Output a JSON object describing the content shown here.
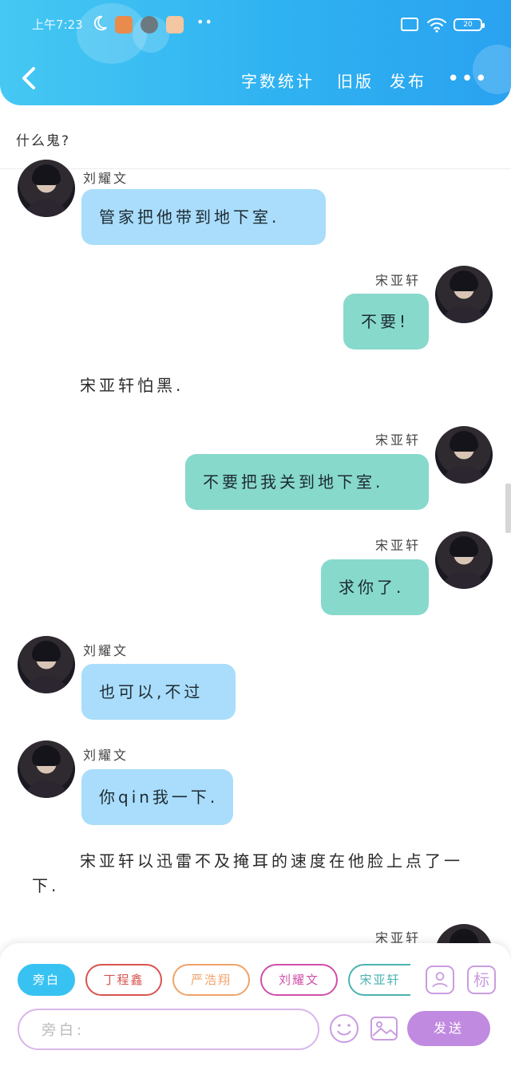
{
  "status_bar": {
    "time": "上午7:23",
    "battery_level": "20"
  },
  "nav": {
    "back_icon": "chevron-left-icon",
    "word_count_label": "字数统计",
    "old_version_label": "旧版",
    "publish_label": "发布",
    "more_icon": "more-dots-icon"
  },
  "story": {
    "title": "什么鬼?"
  },
  "messages": [
    {
      "type": "chat",
      "side": "left",
      "sender": "刘耀文",
      "text": "管家把他带到地下室."
    },
    {
      "type": "chat",
      "side": "right",
      "sender": "宋亚轩",
      "text": "不要!"
    },
    {
      "type": "narration",
      "text": "宋亚轩怕黑."
    },
    {
      "type": "chat",
      "side": "right",
      "sender": "宋亚轩",
      "text": "不要把我关到地下室."
    },
    {
      "type": "chat",
      "side": "right",
      "sender": "宋亚轩",
      "text": "求你了."
    },
    {
      "type": "chat",
      "side": "left",
      "sender": "刘耀文",
      "text": "也可以,不过"
    },
    {
      "type": "chat",
      "side": "left",
      "sender": "刘耀文",
      "text": "你qin我一下."
    },
    {
      "type": "narration",
      "text": "宋亚轩以迅雷不及掩耳的速度在他脸上点了一下."
    },
    {
      "type": "chat",
      "side": "right",
      "sender": "宋亚轩",
      "text": ""
    }
  ],
  "composer": {
    "roles": [
      {
        "label": "旁白",
        "color": "#38c2f2",
        "active": true
      },
      {
        "label": "丁程鑫",
        "color": "#d9534f",
        "active": false
      },
      {
        "label": "严浩翔",
        "color": "#f0a36a",
        "active": false
      },
      {
        "label": "刘耀文",
        "color": "#d14fa7",
        "active": false
      },
      {
        "label": "宋亚轩",
        "color": "#4ab3b0",
        "active": false
      }
    ],
    "role_manage_icon": "person-card-icon",
    "mark_label": "标",
    "input_placeholder": "旁白:",
    "emoji_icon": "smile-icon",
    "image_icon": "image-icon",
    "send_label": "发送"
  },
  "colors": {
    "header": "#2fb2f1",
    "left_bubble": "#a9ddfb",
    "right_bubble": "#87d9cc",
    "send": "#c08ae0"
  }
}
